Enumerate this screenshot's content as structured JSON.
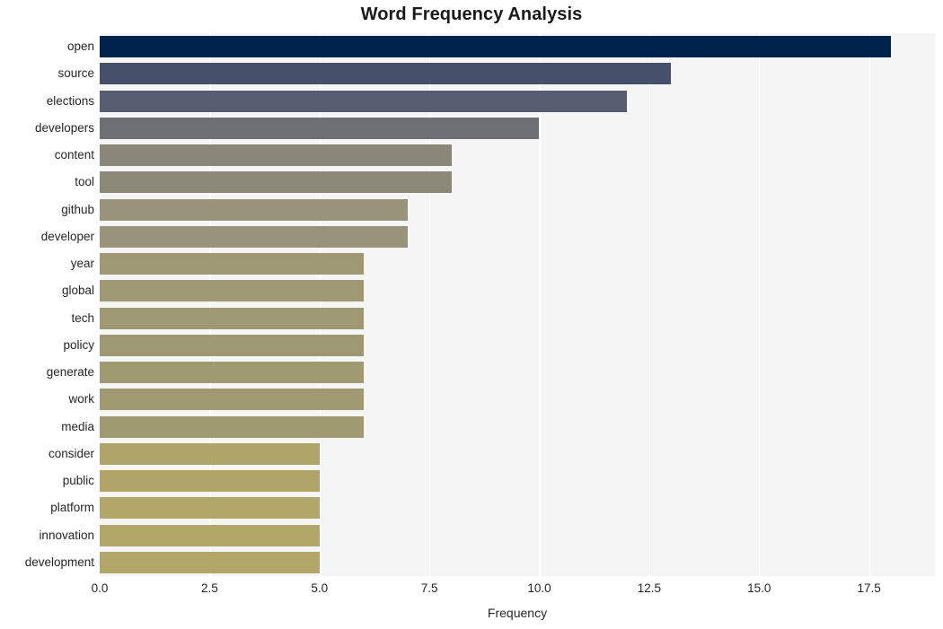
{
  "chart_data": {
    "type": "bar",
    "orientation": "horizontal",
    "title": "Word Frequency Analysis",
    "xlabel": "Frequency",
    "ylabel": "",
    "xlim": [
      0,
      19
    ],
    "xticks": [
      "0.0",
      "2.5",
      "5.0",
      "7.5",
      "10.0",
      "12.5",
      "15.0",
      "17.5"
    ],
    "xtick_values": [
      0,
      2.5,
      5,
      7.5,
      10,
      12.5,
      15,
      17.5
    ],
    "grid": true,
    "grid_color": "#ffffff",
    "plot_background": "#f5f5f5",
    "legend": null,
    "categories": [
      "open",
      "source",
      "elections",
      "developers",
      "content",
      "tool",
      "github",
      "developer",
      "year",
      "global",
      "tech",
      "policy",
      "generate",
      "work",
      "media",
      "consider",
      "public",
      "platform",
      "innovation",
      "development"
    ],
    "values": [
      18,
      13,
      12,
      10,
      8,
      8,
      7,
      7,
      6,
      6,
      6,
      6,
      6,
      6,
      6,
      5,
      5,
      5,
      5,
      5
    ],
    "bar_colors": [
      "#00234d",
      "#47506b",
      "#585c70",
      "#6d6f74",
      "#8a8779",
      "#8b8878",
      "#989379",
      "#989379",
      "#9e9873",
      "#9e9873",
      "#9e9873",
      "#9e9873",
      "#a09a72",
      "#a09a72",
      "#a09a72",
      "#b0a469",
      "#b0a469",
      "#b2a668",
      "#b2a668",
      "#b3a669"
    ]
  }
}
